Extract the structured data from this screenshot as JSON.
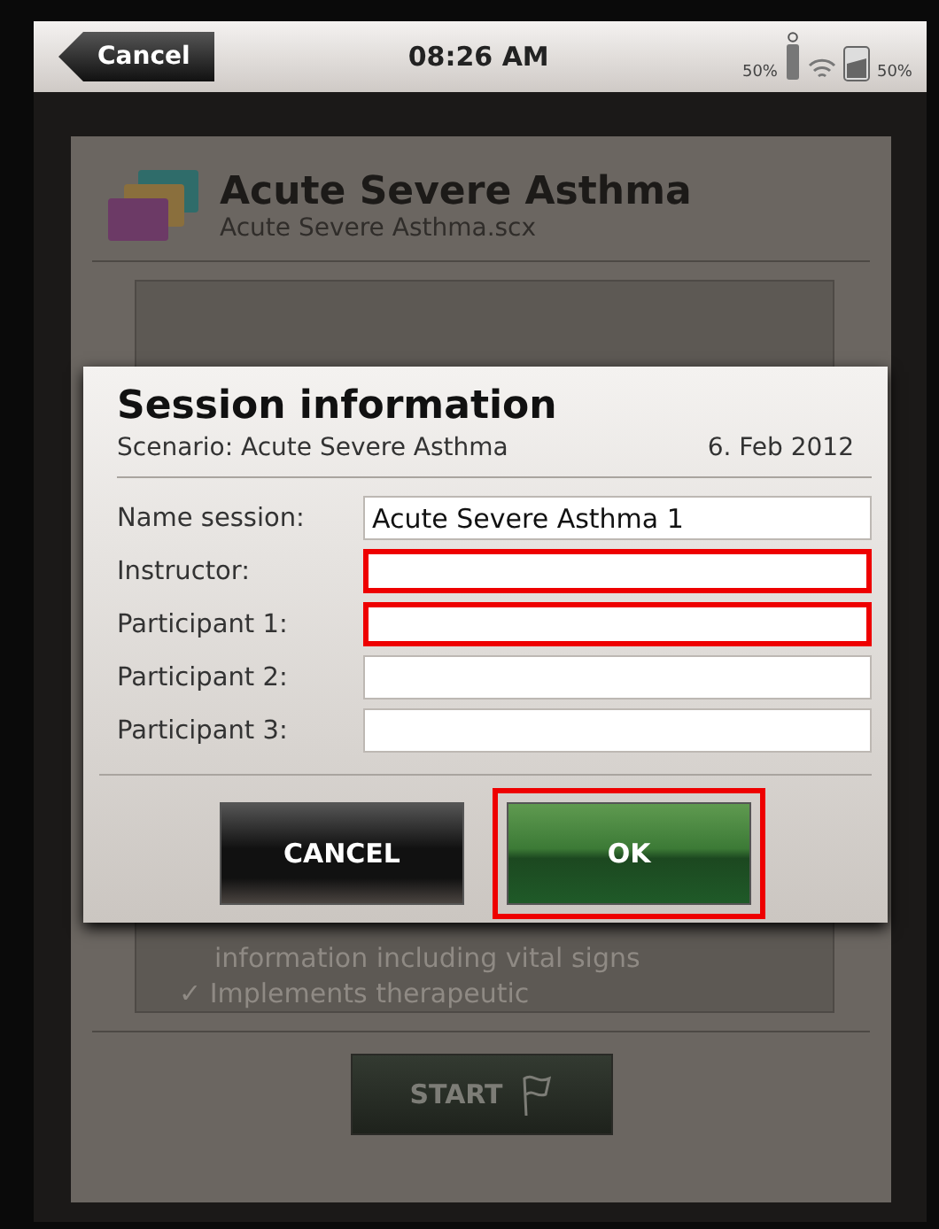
{
  "status_bar": {
    "back_button": "Cancel",
    "time": "08:26 AM",
    "left_reading": "50%",
    "right_reading": "50%"
  },
  "scenario": {
    "title": "Acute Severe Asthma",
    "file": "Acute Severe Asthma.scx",
    "objectives": [
      "information including vital signs",
      "✓ Implements therapeutic"
    ],
    "start_button": "START"
  },
  "dialog": {
    "title": "Session information",
    "subtitle": "Scenario: Acute Severe Asthma",
    "date": "6. Feb 2012",
    "fields": [
      {
        "label": "Name session:",
        "value": "Acute Severe Asthma 1",
        "highlighted": false
      },
      {
        "label": "Instructor:",
        "highlighted": true
      },
      {
        "label": "Participant 1:",
        "highlighted": true
      },
      {
        "label": "Participant 2:",
        "highlighted": false
      },
      {
        "label": "Participant 3:",
        "highlighted": false
      }
    ],
    "buttons": [
      {
        "label": "CANCEL",
        "kind": "cancel",
        "highlighted": false
      },
      {
        "label": "OK",
        "kind": "confirm",
        "highlighted": true
      }
    ]
  }
}
